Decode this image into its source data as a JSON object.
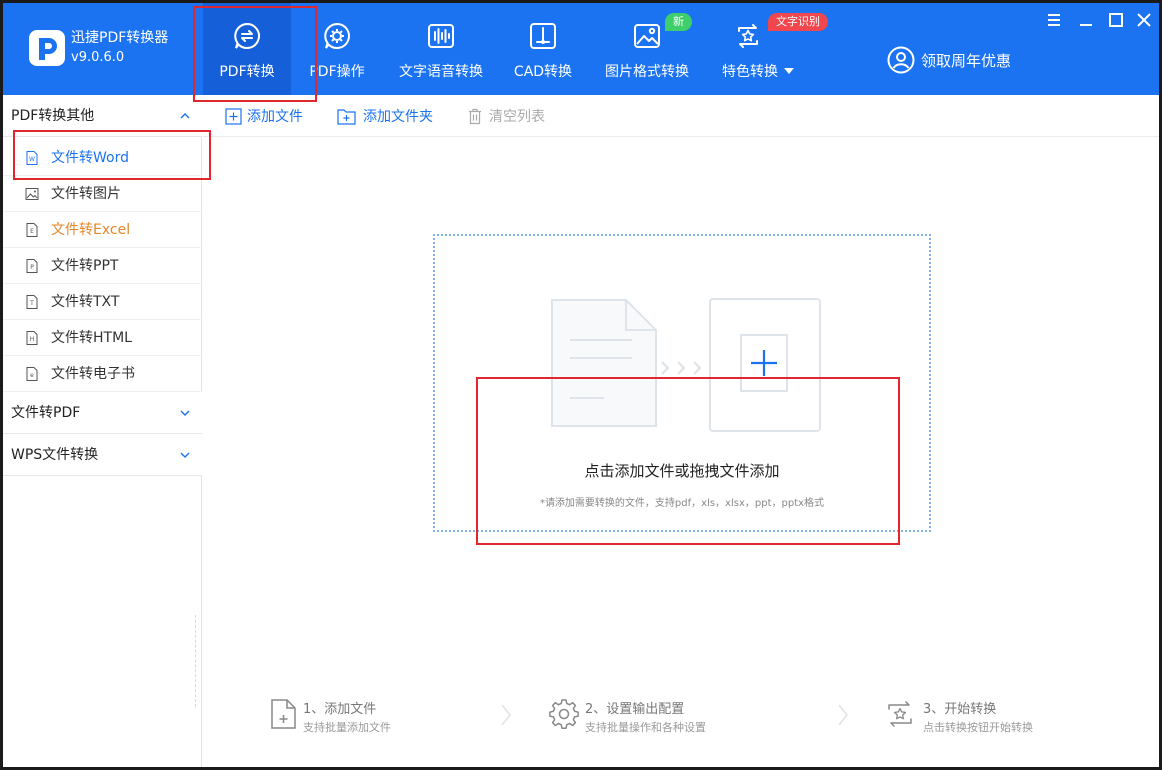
{
  "app": {
    "name": "迅捷PDF转换器",
    "version": "v9.0.6.0"
  },
  "nav": {
    "tabs": [
      {
        "label": "PDF转换"
      },
      {
        "label": "PDF操作"
      },
      {
        "label": "文字语音转换"
      },
      {
        "label": "CAD转换"
      },
      {
        "label": "图片格式转换"
      },
      {
        "label": "特色转换"
      }
    ],
    "badge_new": "新",
    "badge_ocr": "文字识别",
    "promo": "领取周年优惠"
  },
  "sidebar": {
    "sections": [
      {
        "label": "PDF转换其他"
      },
      {
        "label": "文件转PDF"
      },
      {
        "label": "WPS文件转换"
      }
    ],
    "items": [
      {
        "label": "文件转Word",
        "icon": "W"
      },
      {
        "label": "文件转图片"
      },
      {
        "label": "文件转Excel",
        "icon": "E"
      },
      {
        "label": "文件转PPT",
        "icon": "P"
      },
      {
        "label": "文件转TXT",
        "icon": "T"
      },
      {
        "label": "文件转HTML",
        "icon": "H"
      },
      {
        "label": "文件转电子书",
        "icon": "e"
      }
    ]
  },
  "toolbar": {
    "add_file": "添加文件",
    "add_folder": "添加文件夹",
    "clear_list": "清空列表"
  },
  "dropzone": {
    "title": "点击添加文件或拖拽文件添加",
    "hint": "*请添加需要转换的文件，支持pdf，xls，xlsx，ppt，pptx格式"
  },
  "steps": [
    {
      "title": "1、添加文件",
      "sub": "支持批量添加文件"
    },
    {
      "title": "2、设置输出配置",
      "sub": "支持批量操作和各种设置"
    },
    {
      "title": "3、开始转换",
      "sub": "点击转换按钮开始转换"
    }
  ],
  "colors": {
    "brand": "#1b73f2",
    "highlight": "#e0262e",
    "new_badge": "#3fcf6a",
    "ocr_badge": "#f0464d",
    "excel_item": "#e4862b"
  }
}
